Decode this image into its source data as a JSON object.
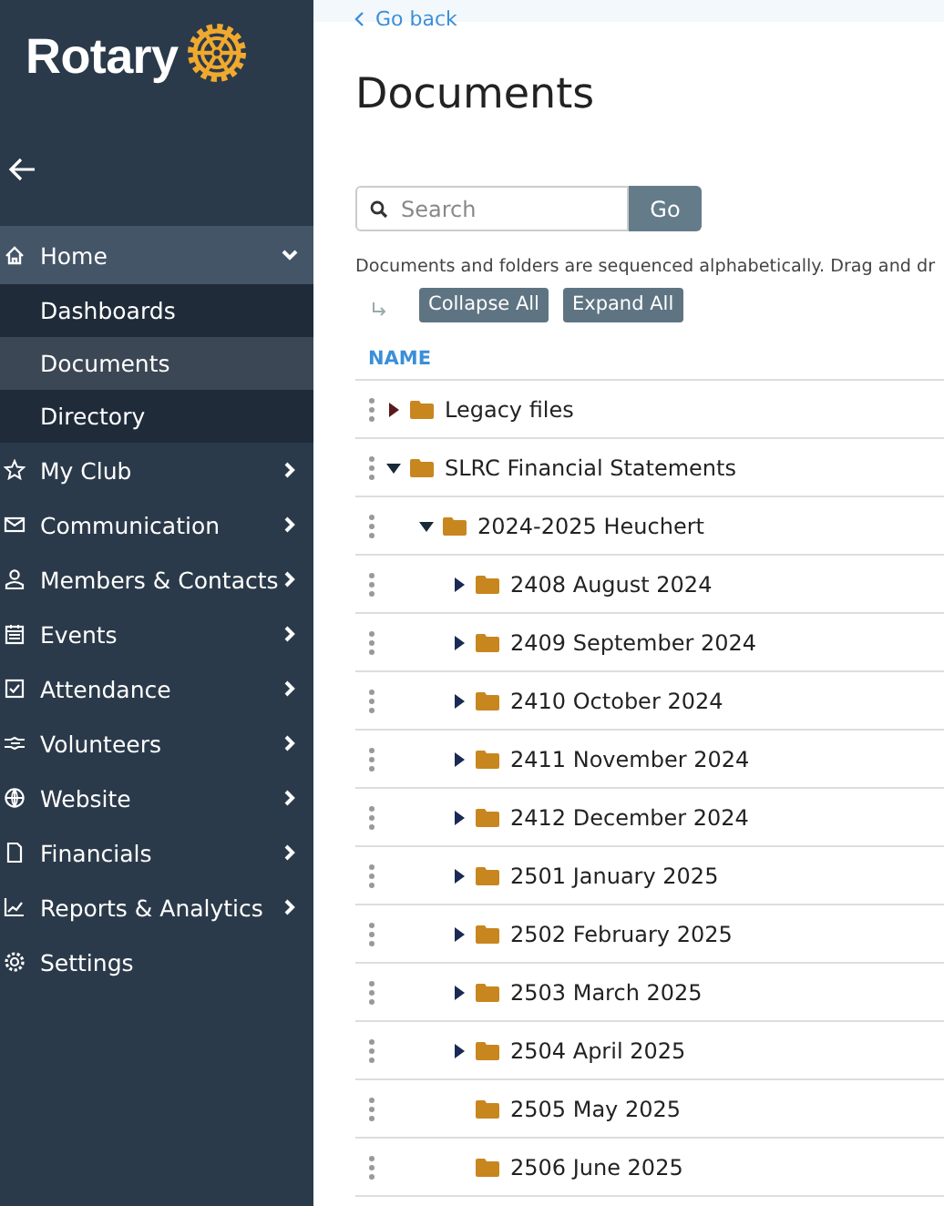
{
  "sidebar": {
    "logo_text": "Rotary",
    "items": [
      {
        "label": "Home",
        "kind": "group",
        "expanded": true,
        "children": [
          {
            "label": "Dashboards",
            "selected": false
          },
          {
            "label": "Documents",
            "selected": true
          },
          {
            "label": "Directory",
            "selected": false
          }
        ]
      },
      {
        "label": "My Club",
        "kind": "group",
        "expanded": false
      },
      {
        "label": "Communication",
        "kind": "group",
        "expanded": false
      },
      {
        "label": "Members & Contacts",
        "kind": "group",
        "expanded": false
      },
      {
        "label": "Events",
        "kind": "group",
        "expanded": false
      },
      {
        "label": "Attendance",
        "kind": "group",
        "expanded": false
      },
      {
        "label": "Volunteers",
        "kind": "group",
        "expanded": false
      },
      {
        "label": "Website",
        "kind": "group",
        "expanded": false
      },
      {
        "label": "Financials",
        "kind": "group",
        "expanded": false
      },
      {
        "label": "Reports & Analytics",
        "kind": "group",
        "expanded": false
      },
      {
        "label": "Settings",
        "kind": "link",
        "expanded": false
      }
    ]
  },
  "main": {
    "back_link": "Go back",
    "title": "Documents",
    "search": {
      "placeholder": "Search",
      "button": "Go"
    },
    "note": "Documents and folders are sequenced alphabetically. Drag and dr",
    "buttons": [
      "Collapse All",
      "Expand All"
    ],
    "table": {
      "columns": [
        "NAME"
      ],
      "tree": [
        {
          "name": "Legacy files",
          "kind": "branch",
          "expanded": false
        },
        {
          "name": "SLRC Financial Statements",
          "kind": "branch",
          "expanded": true,
          "children": [
            {
              "name": "2024-2025 Heuchert",
              "kind": "branch",
              "expanded": true,
              "children": [
                {
                  "name": "2408 August 2024",
                  "kind": "branch",
                  "expanded": false
                },
                {
                  "name": "2409 September 2024",
                  "kind": "branch",
                  "expanded": false
                },
                {
                  "name": "2410 October 2024",
                  "kind": "branch",
                  "expanded": false
                },
                {
                  "name": "2411 November 2024",
                  "kind": "branch",
                  "expanded": false
                },
                {
                  "name": "2412 December 2024",
                  "kind": "branch",
                  "expanded": false
                },
                {
                  "name": "2501 January 2025",
                  "kind": "branch",
                  "expanded": false
                },
                {
                  "name": "2502 February 2025",
                  "kind": "branch",
                  "expanded": false
                },
                {
                  "name": "2503 March 2025",
                  "kind": "branch",
                  "expanded": false
                },
                {
                  "name": "2504 April 2025",
                  "kind": "branch",
                  "expanded": false
                },
                {
                  "name": "2505 May 2025",
                  "kind": "leaf"
                },
                {
                  "name": "2506 June 2025",
                  "kind": "leaf"
                }
              ]
            }
          ]
        }
      ]
    }
  }
}
